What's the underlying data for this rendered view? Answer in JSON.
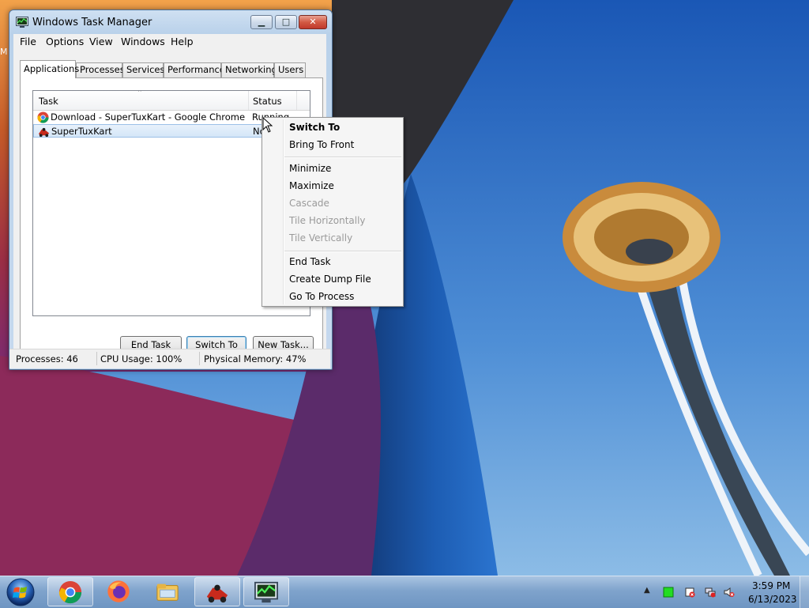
{
  "window": {
    "title": "Windows Task Manager",
    "menu": [
      "File",
      "Options",
      "Windows",
      "Help"
    ],
    "tabs": [
      "Applications",
      "Processes",
      "Services",
      "Performance",
      "Networking",
      "Users"
    ],
    "active_tab": "Applications",
    "list": {
      "columns": [
        "Task",
        "Status"
      ],
      "rows": [
        {
          "task": "Download - SuperTuxKart - Google Chrome",
          "status": "Running",
          "icon": "chrome-icon"
        },
        {
          "task": "SuperTuxKart",
          "status": "No",
          "icon": "supertuxkart-icon"
        }
      ]
    },
    "buttons": {
      "end_task": "End Task",
      "switch_to": "Switch To",
      "new_task": "New Task..."
    },
    "status_bar": {
      "processes": "Processes: 46",
      "cpu": "CPU Usage: 100%",
      "memory": "Physical Memory: 47%"
    }
  },
  "context_menu": {
    "items": [
      {
        "label": "Switch To",
        "enabled": true,
        "default": true
      },
      {
        "label": "Bring To Front",
        "enabled": true
      },
      {
        "label": "Minimize",
        "enabled": true
      },
      {
        "label": "Maximize",
        "enabled": true
      },
      {
        "label": "Cascade",
        "enabled": false
      },
      {
        "label": "Tile Horizontally",
        "enabled": false
      },
      {
        "label": "Tile Vertically",
        "enabled": false
      },
      {
        "label": "End Task",
        "enabled": true
      },
      {
        "label": "Create Dump File",
        "enabled": true
      },
      {
        "label": "Go To Process",
        "enabled": true
      }
    ]
  },
  "taskbar": {
    "apps": [
      "chrome-icon",
      "firefox-icon",
      "file-explorer-icon",
      "supertuxkart-icon",
      "task-manager-icon"
    ],
    "clock": {
      "time": "3:59 PM",
      "date": "6/13/2023"
    }
  },
  "desktop": {
    "edge_text": "M"
  }
}
